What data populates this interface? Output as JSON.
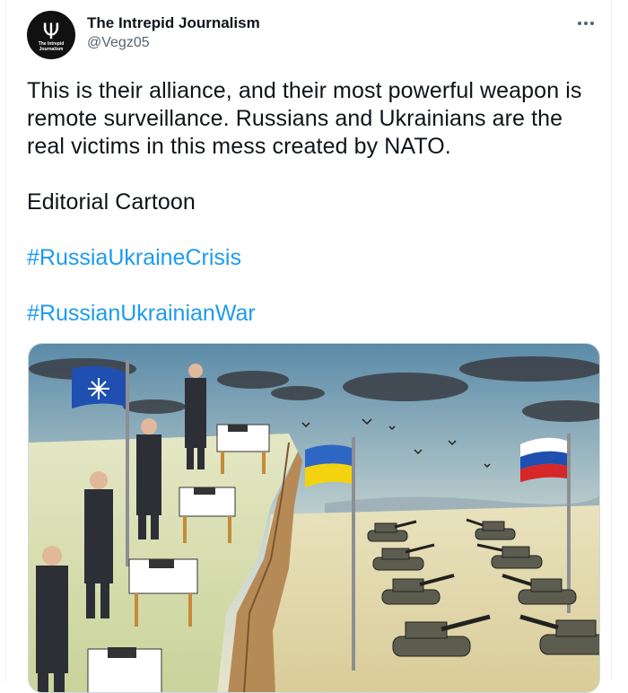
{
  "author": {
    "display_name": "The Intrepid Journalism",
    "handle": "@Vegz05",
    "avatar_text": "The Intrepid Journalism",
    "avatar_icon": "trident-icon"
  },
  "menu": {
    "icon": "more-horizontal-icon"
  },
  "tweet": {
    "paragraphs": [
      "This is their alliance, and their most powerful weapon is remote surveillance.  Russians and Ukrainians are the real victims in this mess created by NATO.",
      "Editorial Cartoon"
    ],
    "hashtags": [
      "#RussiaUkraineCrisis",
      "#RussianUkrainianWar"
    ]
  },
  "colors": {
    "link": "#1d9bf0",
    "secondary_text": "#536471",
    "primary_text": "#0f1419"
  },
  "media": {
    "type": "editorial-cartoon",
    "flags": [
      "NATO",
      "Ukraine",
      "Russia"
    ]
  }
}
